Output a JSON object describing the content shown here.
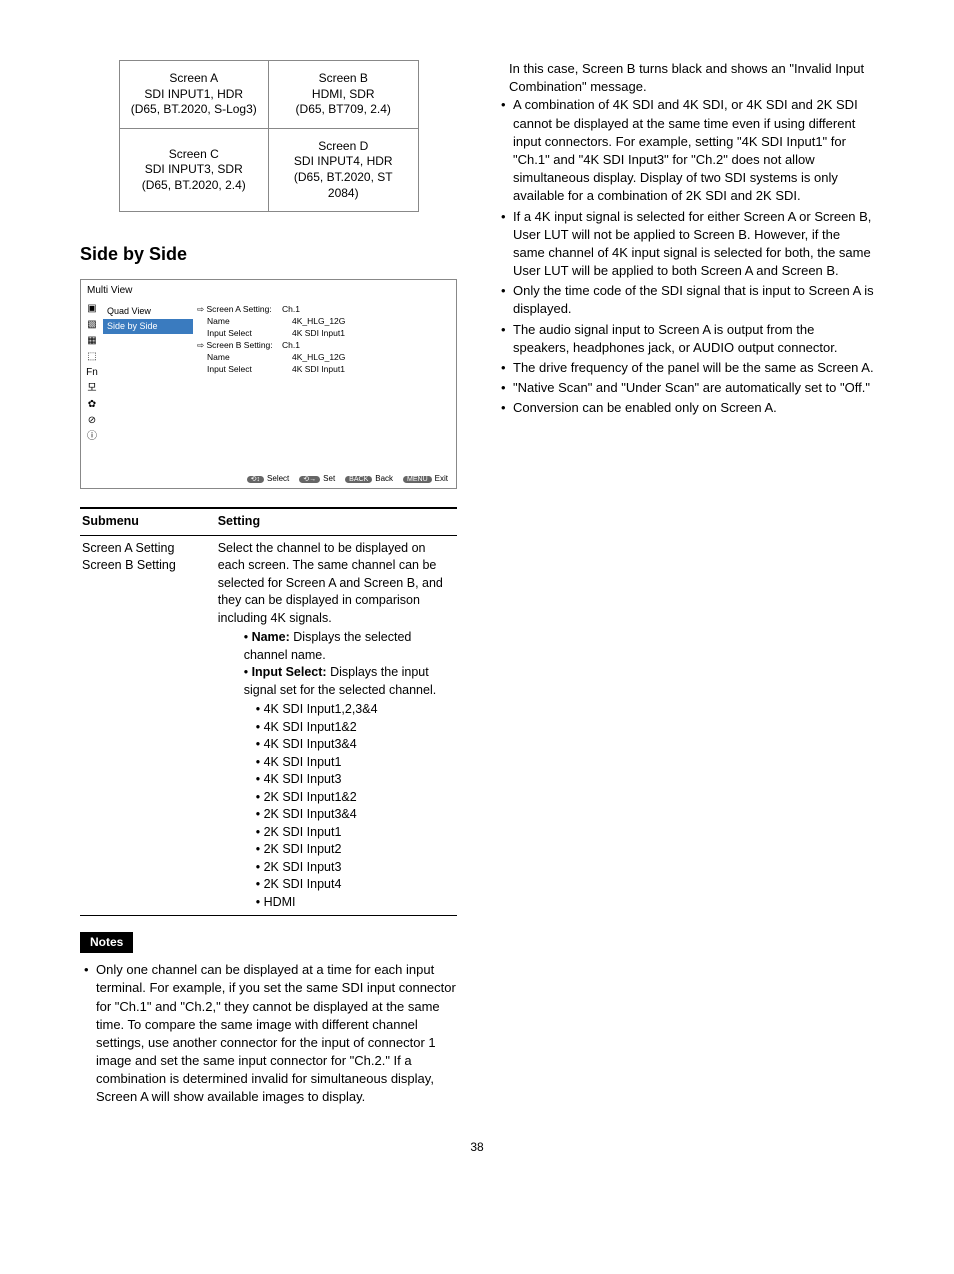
{
  "quad": {
    "a": {
      "title": "Screen A",
      "l1": "SDI INPUT1, HDR",
      "l2": "(D65, BT.2020, S-Log3)"
    },
    "b": {
      "title": "Screen B",
      "l1": "HDMI, SDR",
      "l2": "(D65, BT709, 2.4)"
    },
    "c": {
      "title": "Screen C",
      "l1": "SDI INPUT3, SDR",
      "l2": "(D65, BT.2020, 2.4)"
    },
    "d": {
      "title": "Screen D",
      "l1": "SDI INPUT4, HDR",
      "l2": "(D65, BT.2020, ST 2084)"
    }
  },
  "section_heading": "Side by Side",
  "ui": {
    "title": "Multi View",
    "menu": {
      "item1": "Quad View",
      "item2": "Side by Side"
    },
    "rows": {
      "sa": "⇨ Screen A Setting:",
      "sa_v": "Ch.1",
      "sa_name_k": "Name",
      "sa_name_v": "4K_HLG_12G",
      "sa_in_k": "Input Select",
      "sa_in_v": "4K SDI Input1",
      "sb": "⇨ Screen B Setting:",
      "sb_v": "Ch.1",
      "sb_name_k": "Name",
      "sb_name_v": "4K_HLG_12G",
      "sb_in_k": "Input Select",
      "sb_in_v": "4K SDI Input1"
    },
    "foot": {
      "b1": "⟲↕",
      "t1": "Select",
      "b2": "⟲→",
      "t2": "Set",
      "b3": "BACK",
      "t3": "Back",
      "b4": "MENU",
      "t4": "Exit"
    },
    "fn": "Fn"
  },
  "table": {
    "h1": "Submenu",
    "h2": "Setting",
    "submenu1": "Screen A Setting",
    "submenu2": "Screen B Setting",
    "desc_intro": "Select the channel to be displayed on each screen. The same channel can be selected for Screen A and Screen B, and they can be displayed in comparison including 4K signals.",
    "name_label": "Name:",
    "name_desc": " Displays the selected channel name.",
    "input_label": "Input Select:",
    "input_desc": " Displays the input signal set for the selected channel.",
    "opts": {
      "o1": "4K SDI Input1,2,3&4",
      "o2": "4K SDI Input1&2",
      "o3": "4K SDI Input3&4",
      "o4": "4K SDI Input1",
      "o5": "4K SDI Input3",
      "o6": "2K SDI Input1&2",
      "o7": "2K SDI Input3&4",
      "o8": "2K SDI Input1",
      "o9": "2K SDI Input2",
      "o10": "2K SDI Input3",
      "o11": "2K SDI Input4",
      "o12": "HDMI"
    }
  },
  "notes_label": "Notes",
  "notes_left": {
    "n1": "Only one channel can be displayed at a time for each input terminal. For example, if you set the same SDI input connector for \"Ch.1\" and \"Ch.2,\" they cannot be displayed at the same time. To compare the same image with different channel settings, use another connector for the input of connector 1 image and set the same input connector for \"Ch.2.\" If a combination is determined invalid for simultaneous display, Screen A will show available images to display."
  },
  "notes_right": {
    "intro": "In this case, Screen B turns black and shows an \"Invalid Input Combination\" message.",
    "n1": "A combination of 4K SDI and 4K SDI, or 4K SDI and 2K SDI cannot be displayed at the same time even if using different input connectors. For example, setting \"4K SDI Input1\" for \"Ch.1\" and \"4K SDI Input3\" for \"Ch.2\" does not allow simultaneous display. Display of two SDI systems is only available for a combination of 2K SDI and 2K SDI.",
    "n2": "If a 4K input signal is selected for either Screen A or Screen B, User LUT will not be applied to Screen B. However, if the same channel of 4K input signal is selected for both, the same User LUT will be applied to both Screen A and Screen B.",
    "n3": "Only the time code of the SDI signal that is input to Screen A is displayed.",
    "n4": "The audio signal input to Screen A is output from the speakers, headphones jack, or AUDIO output connector.",
    "n5": "The drive frequency of the panel will be the same as Screen A.",
    "n6": "\"Native Scan\" and \"Under Scan\" are automatically set to \"Off.\"",
    "n7": "Conversion can be enabled only on Screen A."
  },
  "page_number": "38"
}
